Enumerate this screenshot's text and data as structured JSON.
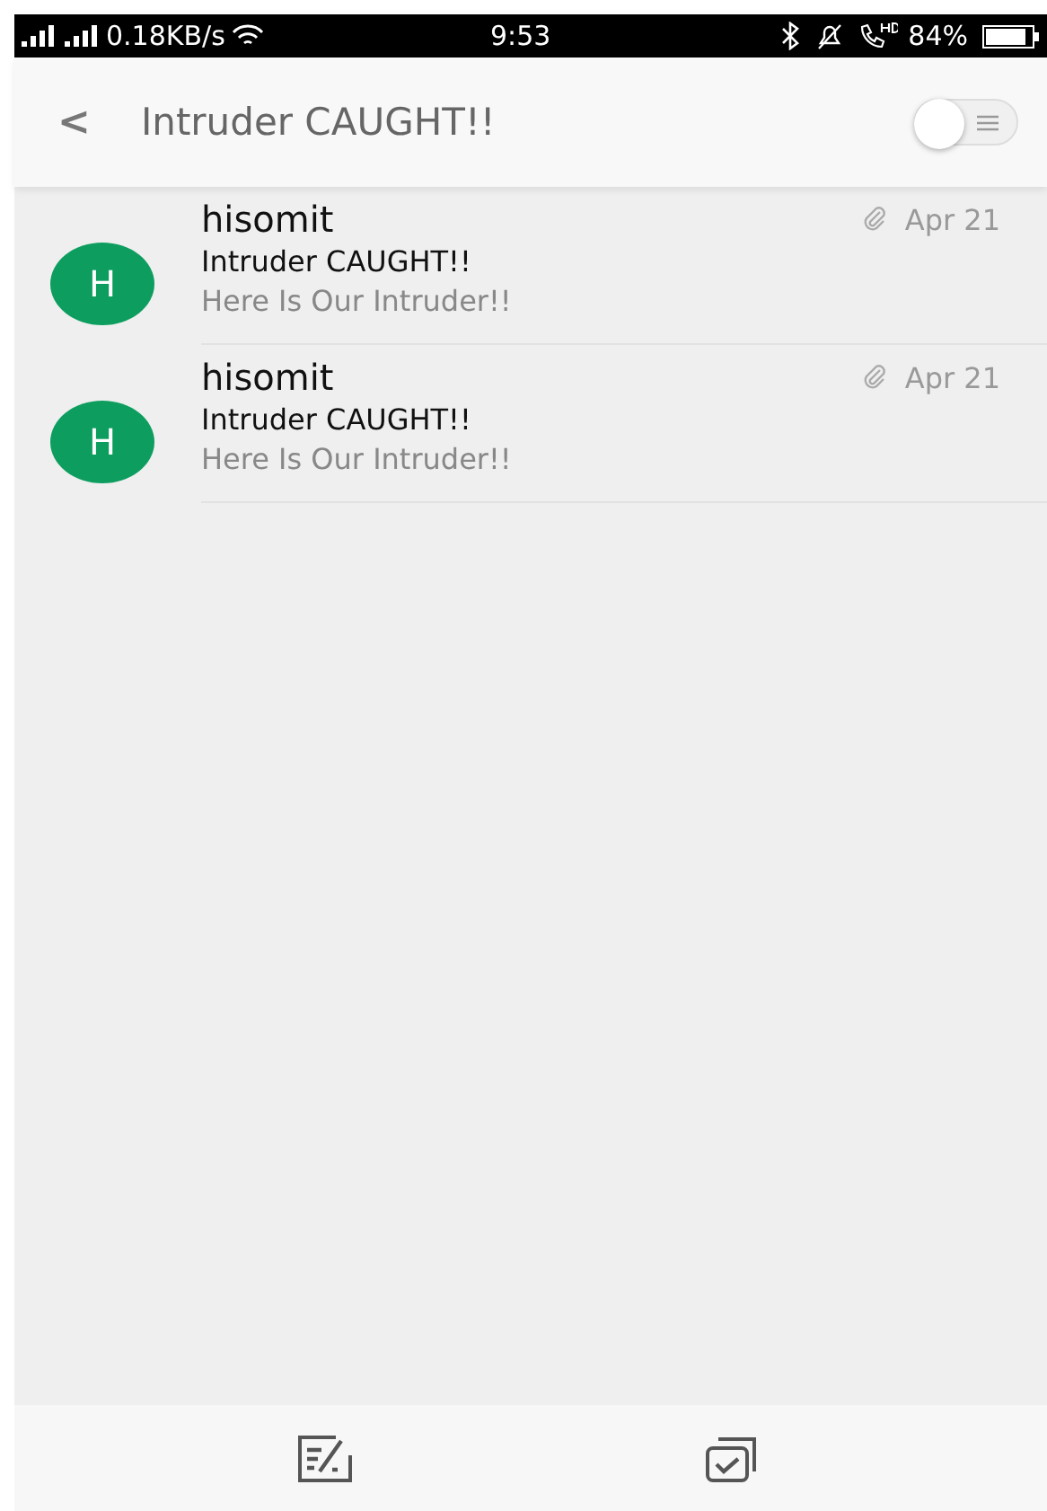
{
  "status_bar": {
    "network_speed": "0.18KB/s",
    "time": "9:53",
    "battery": "84%"
  },
  "header": {
    "back": "<",
    "title": "Intruder CAUGHT!!",
    "toggle": {
      "on": false
    }
  },
  "messages": [
    {
      "avatar": "H",
      "sender": "hisomit",
      "subject": "Intruder CAUGHT!!",
      "preview": "Here Is Our Intruder!!",
      "date": "Apr 21",
      "attachment": true
    },
    {
      "avatar": "H",
      "sender": "hisomit",
      "subject": "Intruder CAUGHT!!",
      "preview": "Here Is Our Intruder!!",
      "date": "Apr 21",
      "attachment": true
    }
  ]
}
